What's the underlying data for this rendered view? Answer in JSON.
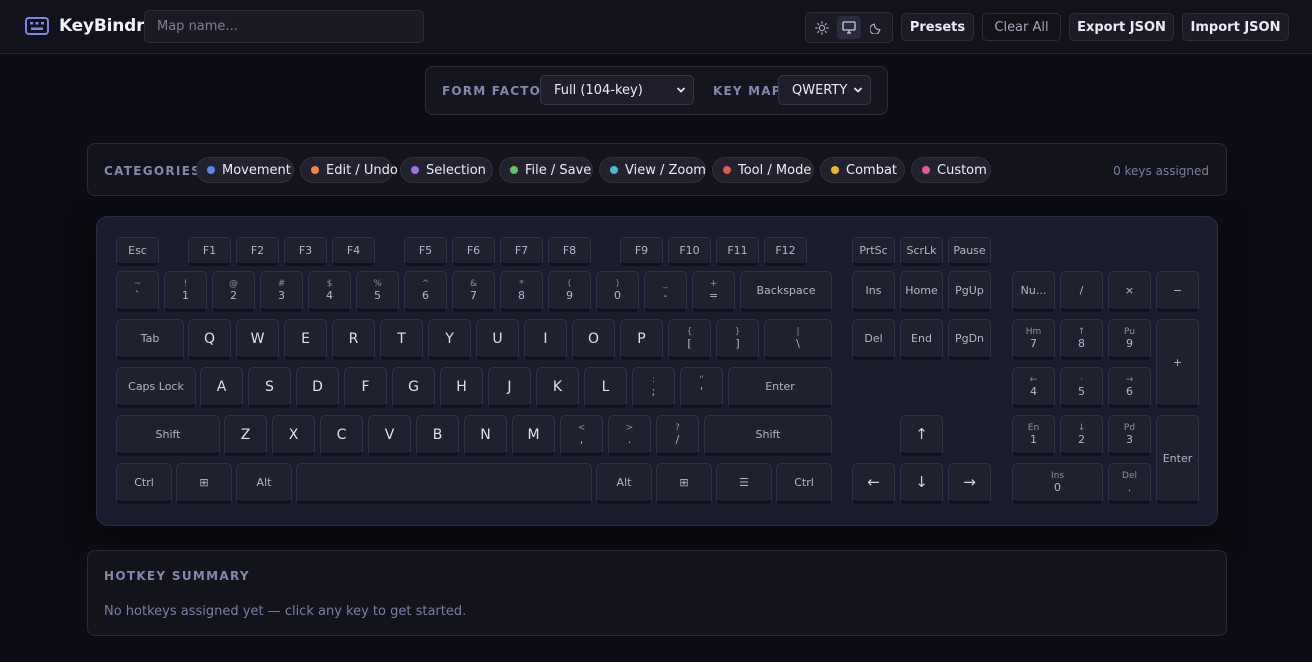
{
  "app": {
    "title": "KeyBindr",
    "map_name_placeholder": "Map name...",
    "map_name_value": ""
  },
  "header": {
    "theme_options": [
      {
        "name": "light",
        "icon": "sun-icon",
        "active": false
      },
      {
        "name": "system",
        "icon": "monitor-icon",
        "active": true
      },
      {
        "name": "dark",
        "icon": "moon-icon",
        "active": false
      }
    ],
    "presets_label": "Presets",
    "clear_label": "Clear All",
    "export_label": "Export JSON",
    "import_label": "Import JSON"
  },
  "layout_bar": {
    "form_factor_label": "FORM FACTOR",
    "form_factor_value": "Full (104-key)",
    "keymap_label": "KEY MAP",
    "keymap_value": "QWERTY"
  },
  "categories": {
    "title": "CATEGORIES",
    "assigned_count": "0 keys assigned",
    "items": [
      {
        "label": "Movement",
        "color": "#5b86e5"
      },
      {
        "label": "Edit / Undo",
        "color": "#f08a3c"
      },
      {
        "label": "Selection",
        "color": "#a06cf0"
      },
      {
        "label": "File / Save",
        "color": "#5ec46a"
      },
      {
        "label": "View / Zoom",
        "color": "#4cb8d4"
      },
      {
        "label": "Tool / Mode",
        "color": "#e25a4a"
      },
      {
        "label": "Combat",
        "color": "#e9b928"
      },
      {
        "label": "Custom",
        "color": "#e25a8f"
      }
    ]
  },
  "keyboard": {
    "function_row": [
      "Esc",
      "F1",
      "F2",
      "F3",
      "F4",
      "F5",
      "F6",
      "F7",
      "F8",
      "F9",
      "F10",
      "F11",
      "F12",
      "PrtSc",
      "ScrLk",
      "Pause"
    ],
    "number_row": [
      {
        "top": "~",
        "bottom": "`"
      },
      {
        "top": "!",
        "bottom": "1"
      },
      {
        "top": "@",
        "bottom": "2"
      },
      {
        "top": "#",
        "bottom": "3"
      },
      {
        "top": "$",
        "bottom": "4"
      },
      {
        "top": "%",
        "bottom": "5"
      },
      {
        "top": "^",
        "bottom": "6"
      },
      {
        "top": "&",
        "bottom": "7"
      },
      {
        "top": "*",
        "bottom": "8"
      },
      {
        "top": "(",
        "bottom": "9"
      },
      {
        "top": ")",
        "bottom": "0"
      },
      {
        "top": "_",
        "bottom": "-"
      },
      {
        "top": "+",
        "bottom": "="
      },
      {
        "label": "Backspace"
      }
    ],
    "top_row": [
      {
        "label": "Tab"
      },
      {
        "label": "Q"
      },
      {
        "label": "W"
      },
      {
        "label": "E"
      },
      {
        "label": "R"
      },
      {
        "label": "T"
      },
      {
        "label": "Y"
      },
      {
        "label": "U"
      },
      {
        "label": "I"
      },
      {
        "label": "O"
      },
      {
        "label": "P"
      },
      {
        "top": "{",
        "bottom": "["
      },
      {
        "top": "}",
        "bottom": "]"
      },
      {
        "top": "|",
        "bottom": "\\"
      }
    ],
    "home_row": [
      {
        "label": "Caps Lock"
      },
      {
        "label": "A"
      },
      {
        "label": "S"
      },
      {
        "label": "D"
      },
      {
        "label": "F"
      },
      {
        "label": "G"
      },
      {
        "label": "H"
      },
      {
        "label": "J"
      },
      {
        "label": "K"
      },
      {
        "label": "L"
      },
      {
        "top": ":",
        "bottom": ";"
      },
      {
        "top": "\"",
        "bottom": "'"
      },
      {
        "label": "Enter"
      }
    ],
    "bottom_row": [
      {
        "label": "Shift"
      },
      {
        "label": "Z"
      },
      {
        "label": "X"
      },
      {
        "label": "C"
      },
      {
        "label": "V"
      },
      {
        "label": "B"
      },
      {
        "label": "N"
      },
      {
        "label": "M"
      },
      {
        "top": "<",
        "bottom": ","
      },
      {
        "top": ">",
        "bottom": "."
      },
      {
        "top": "?",
        "bottom": "/"
      },
      {
        "label": "Shift"
      }
    ],
    "space_row": [
      "Ctrl",
      "⊞",
      "Alt",
      "",
      "Alt",
      "⊞",
      "☰",
      "Ctrl"
    ],
    "nav_cluster": [
      "Ins",
      "Home",
      "PgUp",
      "Del",
      "End",
      "PgDn"
    ],
    "arrows": [
      "↑",
      "←",
      "↓",
      "→"
    ],
    "numpad": [
      {
        "label": "Nu..."
      },
      {
        "label": "/"
      },
      {
        "label": "×"
      },
      {
        "label": "−"
      },
      {
        "top": "Hm",
        "bottom": "7"
      },
      {
        "top": "↑",
        "bottom": "8"
      },
      {
        "top": "Pu",
        "bottom": "9"
      },
      {
        "label": "+"
      },
      {
        "top": "←",
        "bottom": "4"
      },
      {
        "top": "·",
        "bottom": "5"
      },
      {
        "top": "→",
        "bottom": "6"
      },
      {
        "top": "En",
        "bottom": "1"
      },
      {
        "top": "↓",
        "bottom": "2"
      },
      {
        "top": "Pd",
        "bottom": "3"
      },
      {
        "label": "Enter"
      },
      {
        "top": "Ins",
        "bottom": "0"
      },
      {
        "top": "Del",
        "bottom": "."
      }
    ]
  },
  "summary": {
    "title": "HOTKEY SUMMARY",
    "empty_text": "No hotkeys assigned yet — click any key to get started."
  }
}
